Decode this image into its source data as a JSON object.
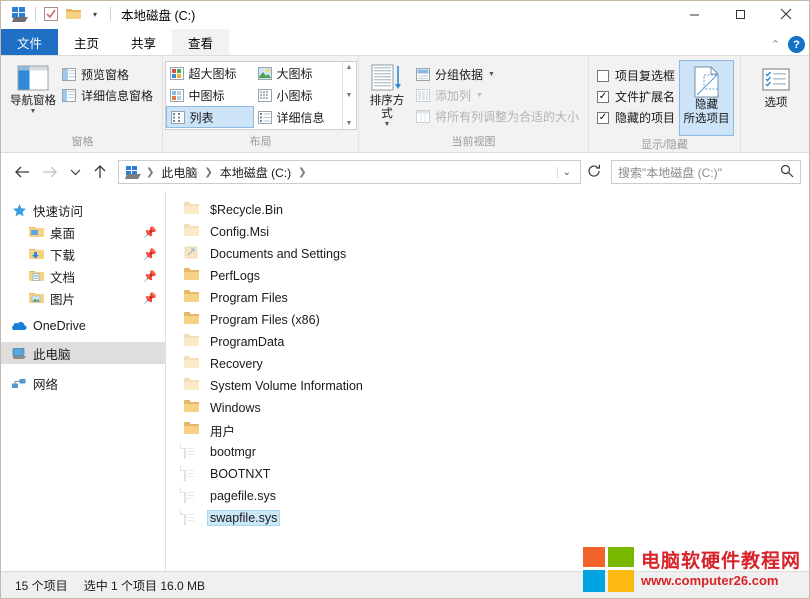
{
  "window": {
    "title": "本地磁盘 (C:)",
    "quick_access_icons": [
      "explorer-icon",
      "properties-icon",
      "new-folder-icon",
      "customize-dropdown-icon"
    ],
    "controls": {
      "minimize": "minimize-icon",
      "maximize": "maximize-icon",
      "close": "close-icon"
    }
  },
  "tabs": [
    {
      "label": "文件",
      "kind": "file"
    },
    {
      "label": "主页",
      "kind": "normal"
    },
    {
      "label": "共享",
      "kind": "normal"
    },
    {
      "label": "查看",
      "kind": "active"
    }
  ],
  "tab_right": {
    "collapse": "chevron-up-icon",
    "help": "?"
  },
  "ribbon": {
    "groups": [
      {
        "name": "panes",
        "label": "窗格",
        "big_button": {
          "label": "导航窗格",
          "has_caret": true
        },
        "small_items": [
          {
            "label": "预览窗格",
            "dim": false
          },
          {
            "label": "详细信息窗格",
            "dim": false
          }
        ]
      },
      {
        "name": "layout",
        "label": "布局",
        "gallery": [
          {
            "label": "超大图标",
            "selected": false
          },
          {
            "label": "大图标",
            "selected": false
          },
          {
            "label": "中图标",
            "selected": false
          },
          {
            "label": "小图标",
            "selected": false
          },
          {
            "label": "列表",
            "selected": true
          },
          {
            "label": "详细信息",
            "selected": false
          }
        ]
      },
      {
        "name": "current-view",
        "label": "当前视图",
        "big_button": {
          "label": "排序方式",
          "has_caret": true
        },
        "small_items": [
          {
            "label": "分组依据",
            "dim": false,
            "dropdown": true
          },
          {
            "label": "添加列",
            "dim": true,
            "dropdown": true
          },
          {
            "label": "将所有列调整为合适的大小",
            "dim": true,
            "dropdown": false
          }
        ]
      },
      {
        "name": "show-hide",
        "label": "显示/隐藏",
        "checkboxes": [
          {
            "label": "项目复选框",
            "checked": false
          },
          {
            "label": "文件扩展名",
            "checked": true
          },
          {
            "label": "隐藏的项目",
            "checked": true
          }
        ],
        "toggle_button": {
          "label_line1": "隐藏",
          "label_line2": "所选项目",
          "active": true
        }
      },
      {
        "name": "options",
        "label": "",
        "big_button": {
          "label": "选项",
          "has_caret": false
        }
      }
    ]
  },
  "address_bar": {
    "back": "back-arrow-icon",
    "forward": "forward-arrow-icon",
    "recent": "chevron-down-icon",
    "up": "up-arrow-icon",
    "breadcrumbs": [
      "此电脑",
      "本地磁盘 (C:)"
    ],
    "dropdown": "chevron-down-icon",
    "refresh": "refresh-icon",
    "search_placeholder": "搜索\"本地磁盘 (C:)\"",
    "search_value": ""
  },
  "nav_pane": {
    "items": [
      {
        "label": "快速访问",
        "icon": "star-pin-icon",
        "level": 0,
        "pinned": false,
        "selected": false
      },
      {
        "label": "桌面",
        "icon": "desktop-folder-icon",
        "level": 1,
        "pinned": true,
        "selected": false
      },
      {
        "label": "下载",
        "icon": "downloads-folder-icon",
        "level": 1,
        "pinned": true,
        "selected": false
      },
      {
        "label": "文档",
        "icon": "documents-folder-icon",
        "level": 1,
        "pinned": true,
        "selected": false
      },
      {
        "label": "图片",
        "icon": "pictures-folder-icon",
        "level": 1,
        "pinned": true,
        "selected": false
      },
      {
        "label": "OneDrive",
        "icon": "onedrive-cloud-icon",
        "level": 0,
        "pinned": false,
        "selected": false
      },
      {
        "label": "此电脑",
        "icon": "this-pc-icon",
        "level": 0,
        "pinned": false,
        "selected": true
      },
      {
        "label": "网络",
        "icon": "network-icon",
        "level": 0,
        "pinned": false,
        "selected": false
      }
    ]
  },
  "file_list": {
    "items": [
      {
        "name": "$Recycle.Bin",
        "type": "folder",
        "hidden": true,
        "selected": false
      },
      {
        "name": "Config.Msi",
        "type": "folder",
        "hidden": true,
        "selected": false
      },
      {
        "name": "Documents and Settings",
        "type": "shortcut",
        "hidden": true,
        "selected": false
      },
      {
        "name": "PerfLogs",
        "type": "folder",
        "hidden": false,
        "selected": false
      },
      {
        "name": "Program Files",
        "type": "folder",
        "hidden": false,
        "selected": false
      },
      {
        "name": "Program Files (x86)",
        "type": "folder",
        "hidden": false,
        "selected": false
      },
      {
        "name": "ProgramData",
        "type": "folder",
        "hidden": true,
        "selected": false
      },
      {
        "name": "Recovery",
        "type": "folder",
        "hidden": true,
        "selected": false
      },
      {
        "name": "System Volume Information",
        "type": "folder",
        "hidden": true,
        "selected": false
      },
      {
        "name": "Windows",
        "type": "folder",
        "hidden": false,
        "selected": false
      },
      {
        "name": "用户",
        "type": "folder",
        "hidden": false,
        "selected": false
      },
      {
        "name": "bootmgr",
        "type": "file",
        "hidden": true,
        "selected": false
      },
      {
        "name": "BOOTNXT",
        "type": "file",
        "hidden": true,
        "selected": false
      },
      {
        "name": "pagefile.sys",
        "type": "file",
        "hidden": true,
        "selected": false
      },
      {
        "name": "swapfile.sys",
        "type": "file",
        "hidden": true,
        "selected": true
      }
    ]
  },
  "status_bar": {
    "count_text": "15 个项目",
    "selection_text": "选中 1 个项目  16.0 MB"
  },
  "watermark": {
    "title": "电脑软硬件教程网",
    "url": "www.computer26.com"
  },
  "colors": {
    "file_tab_blue": "#1f6fc4",
    "selection_blue": "#cce8f7",
    "ribbon_bg": "#f2f2f2",
    "accent_red": "#d8232a"
  }
}
